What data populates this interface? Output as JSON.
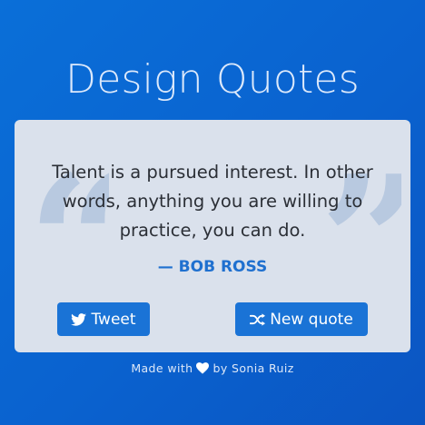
{
  "app": {
    "title": "Design Quotes"
  },
  "quote": {
    "text": "Talent is a pursued interest. In other words, anything you are willing to practice, you can do.",
    "author": "— BOB ROSS",
    "open_mark": "“",
    "close_mark": "”"
  },
  "buttons": {
    "tweet_label": "Tweet",
    "tweet_icon": "twitter-icon",
    "new_quote_label": "New quote",
    "new_quote_icon": "shuffle-icon"
  },
  "footer": {
    "made_with": "Made with",
    "heart_icon": "heart-icon",
    "by": "by Sonia Ruiz"
  },
  "colors": {
    "background": "#0a66d2",
    "card": "#dae1ec",
    "accent": "#1a73d6",
    "author": "#1f70cf",
    "quote_marks": "#b8c9e0"
  }
}
